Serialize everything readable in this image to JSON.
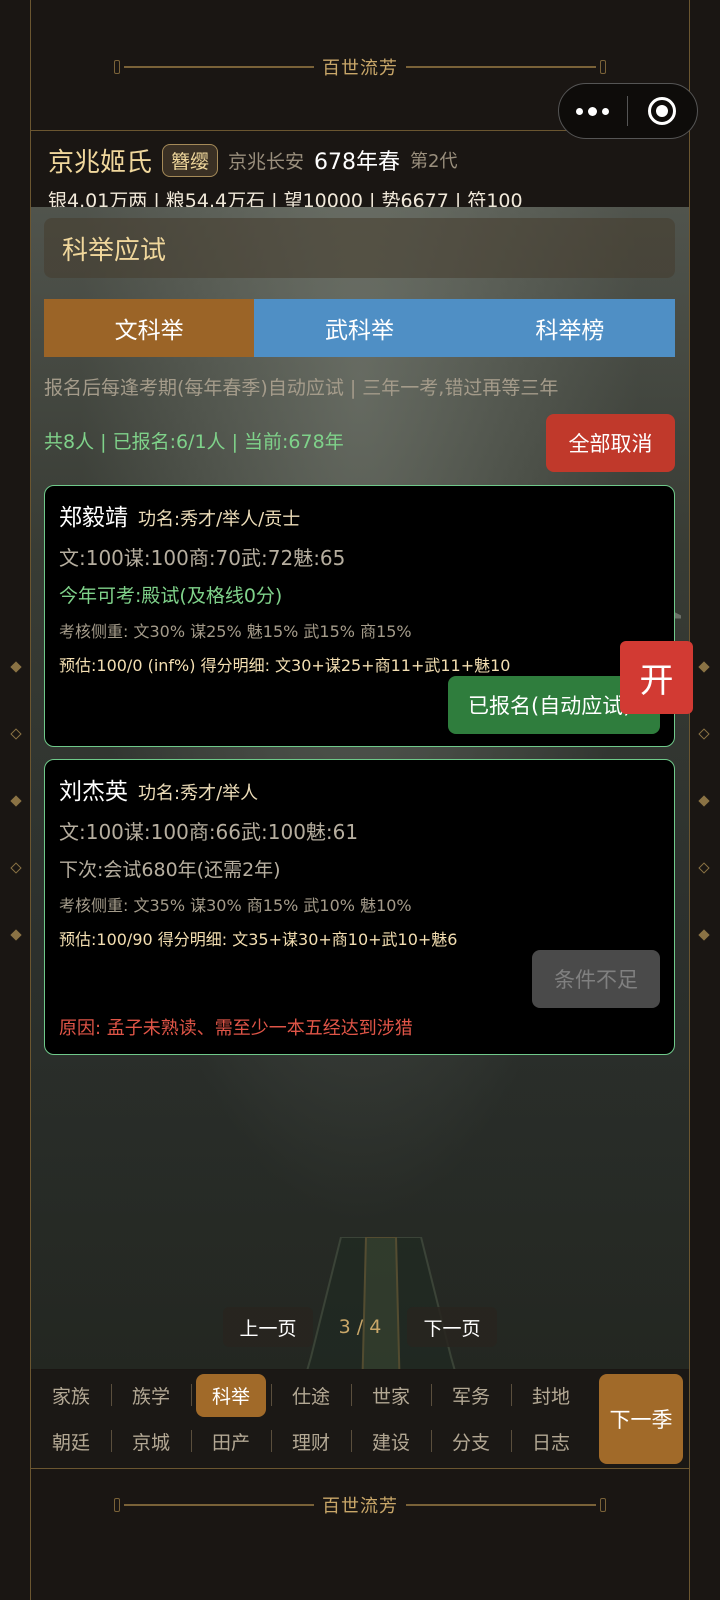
{
  "banner": {
    "title": "百世流芳"
  },
  "header": {
    "clan_name": "京兆姬氏",
    "badge": "簪缨",
    "location": "京兆长安",
    "year": "678年春",
    "generation": "第2代",
    "resources": "银4.01万两 | 粮54.4万石 | 望10000 | 势6677 | 符100"
  },
  "panel": {
    "title": "科举应试",
    "tabs": [
      {
        "label": "文科举",
        "active": true
      },
      {
        "label": "武科举",
        "active": false
      },
      {
        "label": "科举榜",
        "active": false
      }
    ],
    "note": "报名后每逢考期(每年春季)自动应试 | 三年一考,错过再等三年",
    "summary": "共8人 | 已报名:6/1人 | 当前:678年",
    "cancel_all": "全部取消"
  },
  "candidates": [
    {
      "name": "郑毅靖",
      "rank": "功名:秀才/举人/贡士",
      "stats": "文:100谋:100商:70武:72魅:65",
      "status": "今年可考:殿试(及格线0分)",
      "focus": "考核侧重: 文30% 谋25% 魅15% 武15% 商15%",
      "estimate": "预估:100/0 (inf%)  得分明细: 文30+谋25+商11+武11+魅10",
      "button": "已报名(自动应试)"
    },
    {
      "name": "刘杰英",
      "rank": "功名:秀才/举人",
      "stats": "文:100谋:100商:66武:100魅:61",
      "status": "下次:会试680年(还需2年)",
      "focus": "考核侧重: 文35% 谋30% 商15% 武10% 魅10%",
      "estimate": "预估:100/90  得分明细: 文35+谋30+商10+武10+魅6",
      "button": "条件不足",
      "reason": "原因: 孟子未熟读、需至少一本五经达到涉猎"
    }
  ],
  "floating": {
    "kai": "开"
  },
  "pager": {
    "prev": "上一页",
    "page": "3 / 4",
    "next": "下一页"
  },
  "nav": {
    "row1": [
      "家族",
      "族学",
      "科举",
      "仕途",
      "世家",
      "军务",
      "封地"
    ],
    "row2": [
      "朝廷",
      "京城",
      "田产",
      "理财",
      "建设",
      "分支",
      "日志"
    ],
    "active": "科举",
    "next_season": "下一季"
  },
  "colors": {
    "accent_gold": "#c9a769",
    "tab_active": "#9b6427",
    "tab_inactive": "#4f8fc5",
    "cancel_red": "#c0392b",
    "registered_green": "#2f7d3d",
    "status_green": "#7fd28a",
    "reason_red": "#e05547"
  }
}
